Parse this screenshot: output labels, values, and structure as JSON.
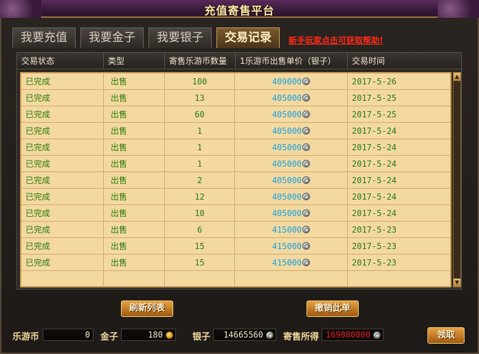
{
  "window": {
    "title": "充值寄售平台"
  },
  "tabs": [
    {
      "label": "我要充值",
      "active": false
    },
    {
      "label": "我要金子",
      "active": false
    },
    {
      "label": "我要银子",
      "active": false
    },
    {
      "label": "交易记录",
      "active": true
    }
  ],
  "help_link": "新手玩家点击可获取帮助!",
  "table": {
    "headers": [
      "交易状态",
      "类型",
      "寄售乐游币数量",
      "1乐游币出售单价（银子）",
      "交易时间"
    ],
    "rows": [
      {
        "status": "已完成",
        "type": "出售",
        "qty": "100",
        "price": "409000",
        "time": "2017-5-26"
      },
      {
        "status": "已完成",
        "type": "出售",
        "qty": "13",
        "price": "405000",
        "time": "2017-5-25"
      },
      {
        "status": "已完成",
        "type": "出售",
        "qty": "60",
        "price": "405000",
        "time": "2017-5-25"
      },
      {
        "status": "已完成",
        "type": "出售",
        "qty": "1",
        "price": "405000",
        "time": "2017-5-24"
      },
      {
        "status": "已完成",
        "type": "出售",
        "qty": "1",
        "price": "405000",
        "time": "2017-5-24"
      },
      {
        "status": "已完成",
        "type": "出售",
        "qty": "1",
        "price": "405000",
        "time": "2017-5-24"
      },
      {
        "status": "已完成",
        "type": "出售",
        "qty": "2",
        "price": "405000",
        "time": "2017-5-24"
      },
      {
        "status": "已完成",
        "type": "出售",
        "qty": "12",
        "price": "405000",
        "time": "2017-5-24"
      },
      {
        "status": "已完成",
        "type": "出售",
        "qty": "10",
        "price": "405000",
        "time": "2017-5-24"
      },
      {
        "status": "已完成",
        "type": "出售",
        "qty": "6",
        "price": "415000",
        "time": "2017-5-23"
      },
      {
        "status": "已完成",
        "type": "出售",
        "qty": "15",
        "price": "415000",
        "time": "2017-5-23"
      },
      {
        "status": "已完成",
        "type": "出售",
        "qty": "15",
        "price": "415000",
        "time": "2017-5-23"
      }
    ]
  },
  "buttons": {
    "refresh": "刷新列表",
    "cancel": "撤销此单",
    "claim": "领取"
  },
  "footer": {
    "leyoubi_label": "乐游币",
    "leyoubi_value": "0",
    "gold_label": "金子",
    "gold_value": "180",
    "silver_label": "银子",
    "silver_value": "14665560",
    "proceeds_label": "寄售所得",
    "proceeds_value": "169880000"
  },
  "colors": {
    "accent": "#c89a50",
    "price": "#1aa0e0",
    "proceeds": "#e02020",
    "status": "#2a7a10"
  }
}
